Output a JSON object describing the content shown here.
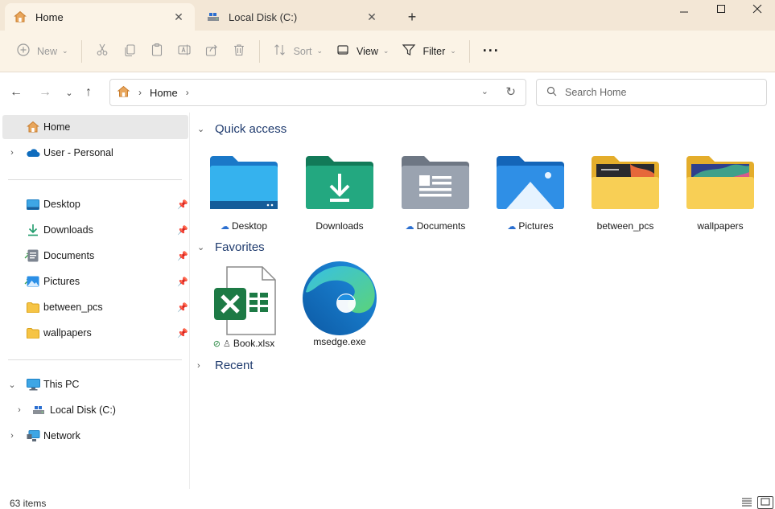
{
  "tabs": [
    {
      "label": "Home",
      "icon": "home-icon"
    },
    {
      "label": "Local Disk (C:)",
      "icon": "drive-icon"
    }
  ],
  "toolbar": {
    "new_label": "New",
    "sort_label": "Sort",
    "view_label": "View",
    "filter_label": "Filter",
    "more_label": "···"
  },
  "address": {
    "breadcrumb": "Home"
  },
  "search": {
    "placeholder": "Search Home"
  },
  "sidebar": {
    "home": "Home",
    "user": "User - Personal",
    "pinned": [
      {
        "label": "Desktop",
        "icon": "desktop-icon"
      },
      {
        "label": "Downloads",
        "icon": "downloads-icon"
      },
      {
        "label": "Documents",
        "icon": "documents-icon"
      },
      {
        "label": "Pictures",
        "icon": "pictures-icon"
      },
      {
        "label": "between_pcs",
        "icon": "folder-icon"
      },
      {
        "label": "wallpapers",
        "icon": "folder-icon"
      }
    ],
    "this_pc": "This PC",
    "local_disk": "Local Disk (C:)",
    "network": "Network"
  },
  "content": {
    "quick_access_header": "Quick access",
    "favorites_header": "Favorites",
    "recent_header": "Recent",
    "quick_access": [
      {
        "label": "Desktop",
        "cloud": true
      },
      {
        "label": "Downloads",
        "cloud": false
      },
      {
        "label": "Documents",
        "cloud": true
      },
      {
        "label": "Pictures",
        "cloud": true
      },
      {
        "label": "between_pcs",
        "cloud": false
      },
      {
        "label": "wallpapers",
        "cloud": false
      }
    ],
    "favorites": [
      {
        "label": "Book.xlsx"
      },
      {
        "label": "msedge.exe"
      }
    ]
  },
  "status": {
    "item_count": "63 items"
  },
  "colors": {
    "titlebar": "#f3e7d6",
    "commandbar": "#fbf3e6",
    "accent_blue": "#2b6fd0",
    "header_text": "#1f3b6e",
    "selection": "#e8e8e8"
  }
}
